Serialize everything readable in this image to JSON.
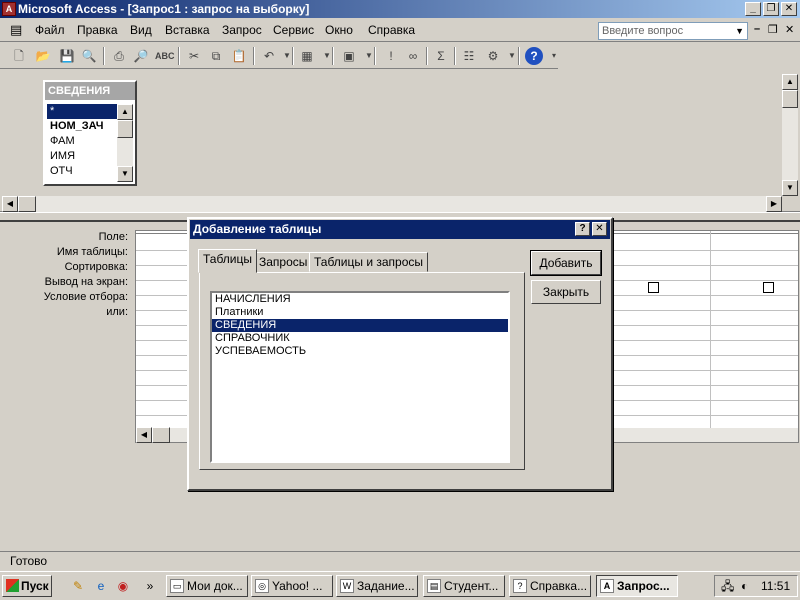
{
  "window": {
    "title": "Microsoft Access - [Запрос1 : запрос на выборку]"
  },
  "menu": [
    "Файл",
    "Правка",
    "Вид",
    "Вставка",
    "Запрос",
    "Сервис",
    "Окно",
    "Справка"
  ],
  "ask": {
    "placeholder": "Введите вопрос"
  },
  "field_list": {
    "title": "СВЕДЕНИЯ",
    "fields": [
      "*",
      "НОМ_ЗАЧ",
      "ФАМ",
      "ИМЯ",
      "ОТЧ"
    ]
  },
  "grid": {
    "row_labels": [
      "Поле:",
      "Имя таблицы:",
      "Сортировка:",
      "Вывод на экран:",
      "Условие отбора:",
      "или:"
    ]
  },
  "dialog": {
    "title": "Добавление таблицы",
    "tabs": [
      "Таблицы",
      "Запросы",
      "Таблицы и запросы"
    ],
    "tables": [
      "НАЧИСЛЕНИЯ",
      "Платники",
      "СВЕДЕНИЯ",
      "СПРАВОЧНИК",
      "УСПЕВАЕМОСТЬ"
    ],
    "selected_index": 2,
    "add_label": "Добавить",
    "close_label": "Закрыть"
  },
  "status": "Готово",
  "taskbar": {
    "start": "Пуск",
    "tasks": [
      "Мои док...",
      "Yahoo! ...",
      "Задание...",
      "Студент...",
      "Справка...",
      "Запрос..."
    ],
    "clock": "11:51"
  }
}
